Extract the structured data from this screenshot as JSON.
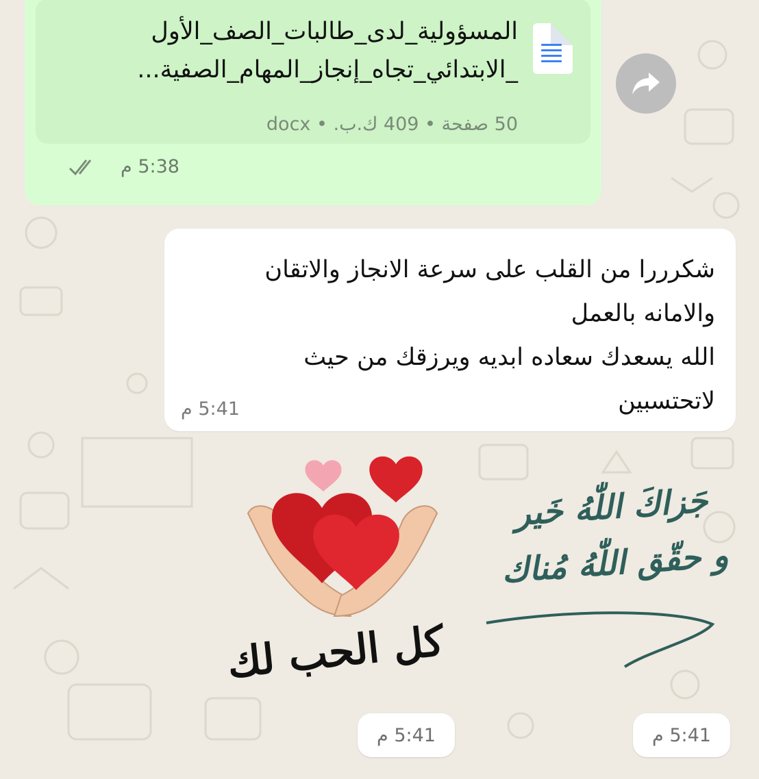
{
  "chat": {
    "outgoing_document": {
      "title_lines": [
        "المسؤولية_لدى_طالبات_الصف_الأول",
        "_الابتدائي_تجاه_إنجاز_المهام_الصفية..."
      ],
      "meta": "50 صفحة • 409 ك.ب. • docx",
      "time": "5:38 م",
      "status_icon": "double-check-icon"
    },
    "forward_icon": "forward-icon",
    "incoming_message": {
      "lines": [
        "شكرررا من القلب على سرعة الانجاز والاتقان",
        "والامانه بالعمل",
        "الله يسعدك سعاده ابديه ويرزقك من حيث",
        "لاتحتسبين"
      ],
      "time": "5:41 م"
    },
    "stickers": [
      {
        "caption": "كل الحب لك",
        "time": "5:41 م"
      },
      {
        "caption_lines": [
          "جَزاكَ اللّٰهُ خَير",
          "و حقّق اللّٰهُ مُناك"
        ],
        "time": "5:41 م"
      }
    ]
  },
  "colors": {
    "wallpaper": "#efeae2",
    "outgoing_bubble": "#d9fdd3",
    "incoming_bubble": "#ffffff",
    "heart_red": "#d8232a",
    "calligraphy_teal": "#2f5f5a"
  }
}
